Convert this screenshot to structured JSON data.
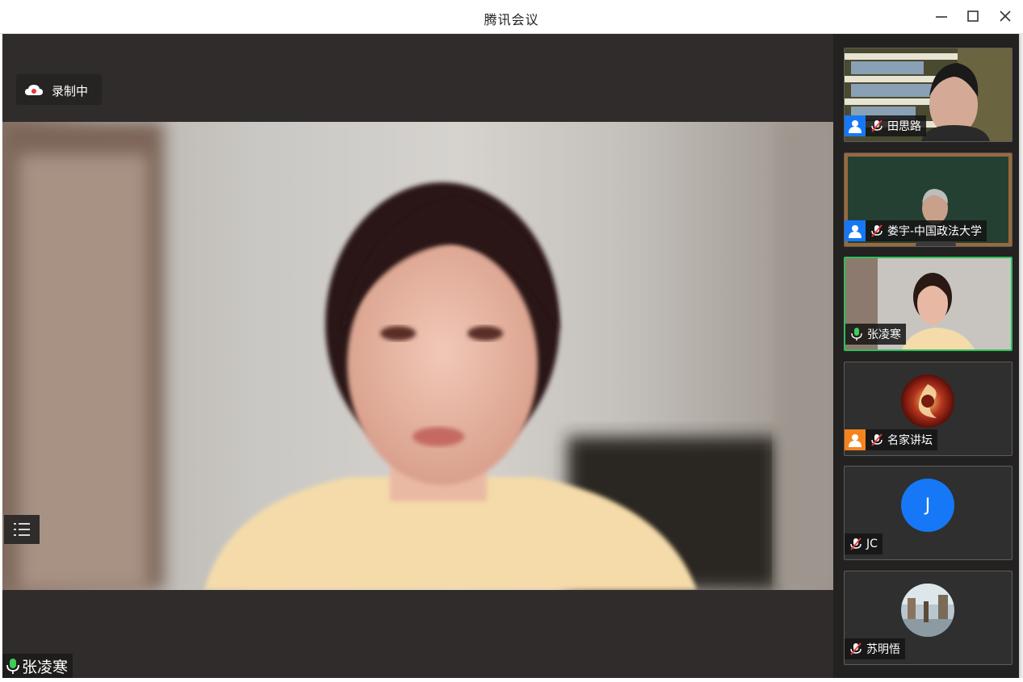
{
  "window": {
    "title": "腾讯会议"
  },
  "main": {
    "recording_label": "录制中",
    "speaker_name": "张凌寒"
  },
  "participants": [
    {
      "name": "田思路",
      "mic": "muted",
      "avatar": "user-icon",
      "avatar_color": "#1678f6"
    },
    {
      "name": "娄宇-中国政法大学",
      "mic": "muted",
      "avatar": "user-icon",
      "avatar_color": "#1678f6"
    },
    {
      "name": "张凌寒",
      "mic": "active",
      "avatar": "none",
      "speaking": true
    },
    {
      "name": "名家讲坛",
      "mic": "muted",
      "avatar": "user-icon",
      "avatar_color": "#f5841f"
    },
    {
      "name": "JC",
      "mic": "muted",
      "initial": "J",
      "initial_color": "#1678f6"
    },
    {
      "name": "苏明悟",
      "mic": "muted",
      "avatar": "photo-avatar"
    }
  ],
  "colors": {
    "accent_blue": "#1678f6",
    "speaking_green": "#2fbf5b",
    "mic_green": "#3ccf56",
    "stage_bg": "#2f2c2b"
  }
}
